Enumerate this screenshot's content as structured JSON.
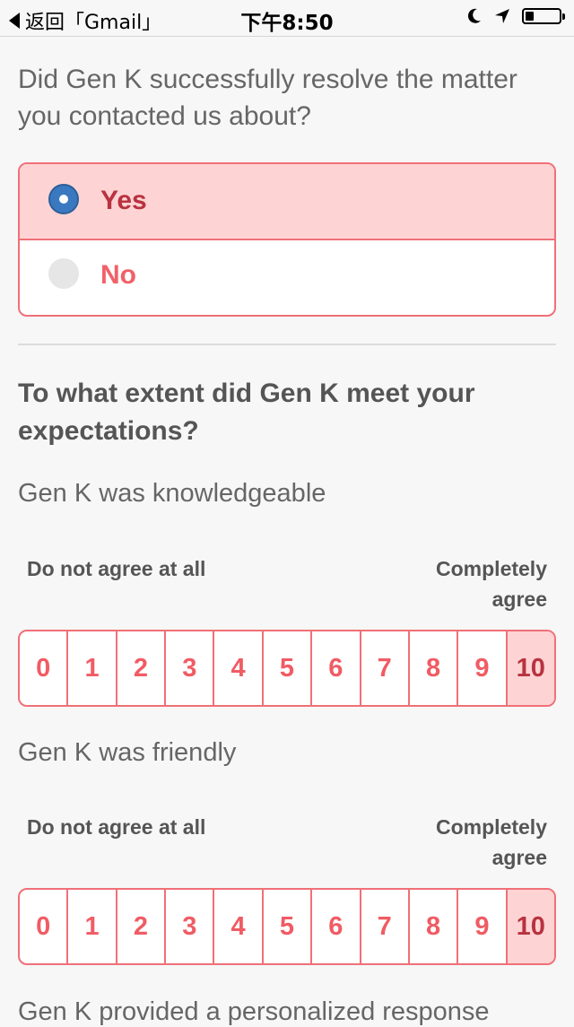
{
  "status_bar": {
    "back_label": "返回「Gmail」",
    "time": "下午8:50",
    "icons": [
      "moon-icon",
      "location-arrow-icon",
      "battery-icon"
    ],
    "battery_level": 0.25
  },
  "survey": {
    "q1": {
      "title": "Did Gen K successfully resolve the matter you contacted us about?",
      "options": [
        {
          "label": "Yes",
          "selected": true
        },
        {
          "label": "No",
          "selected": false
        }
      ]
    },
    "q2": {
      "title": "To what extent did Gen K meet your expectations?",
      "items": [
        {
          "statement": "Gen K was knowledgeable",
          "low_label": "Do not agree at all",
          "high_label": "Completely agree",
          "values": [
            "0",
            "1",
            "2",
            "3",
            "4",
            "5",
            "6",
            "7",
            "8",
            "9",
            "10"
          ],
          "selected": "10"
        },
        {
          "statement": "Gen K was friendly",
          "low_label": "Do not agree at all",
          "high_label": "Completely agree",
          "values": [
            "0",
            "1",
            "2",
            "3",
            "4",
            "5",
            "6",
            "7",
            "8",
            "9",
            "10"
          ],
          "selected": "10"
        }
      ],
      "next_statement": "Gen K provided a personalized response"
    }
  },
  "colors": {
    "accent": "#f07078",
    "selected_bg": "#fed3d4",
    "selected_text": "#b8323f",
    "radio_on": "#3a79c0"
  }
}
